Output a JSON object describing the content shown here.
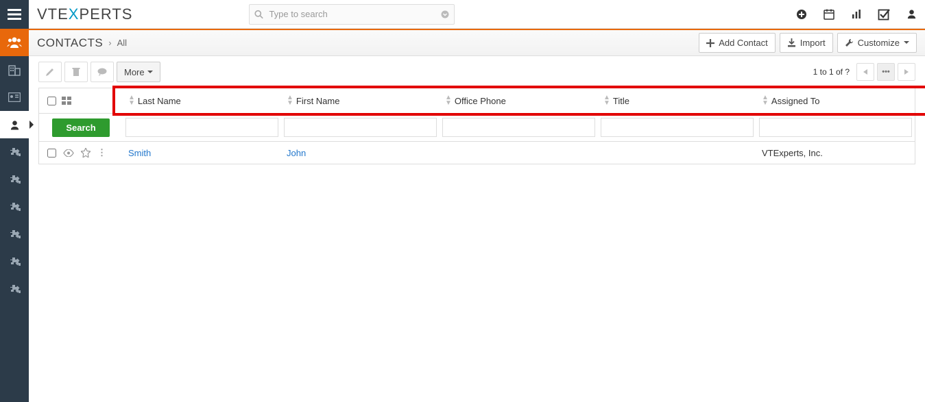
{
  "search": {
    "placeholder": "Type to search"
  },
  "logo": {
    "pre": "VTE",
    "mid": "X",
    "post": "PERTS"
  },
  "header": {
    "title": "CONTACTS",
    "sublabel": "All",
    "actions": {
      "add": "Add Contact",
      "import": "Import",
      "customize": "Customize"
    }
  },
  "toolbar": {
    "more": "More"
  },
  "pagination": {
    "text": "1 to 1  of ?"
  },
  "columns": {
    "c0": "Last Name",
    "c1": "First Name",
    "c2": "Office Phone",
    "c3": "Title",
    "c4": "Assigned To"
  },
  "search_button": "Search",
  "row": {
    "lastname": "Smith",
    "firstname": "John",
    "phone": "",
    "title": "",
    "assigned": "VTExperts, Inc."
  }
}
